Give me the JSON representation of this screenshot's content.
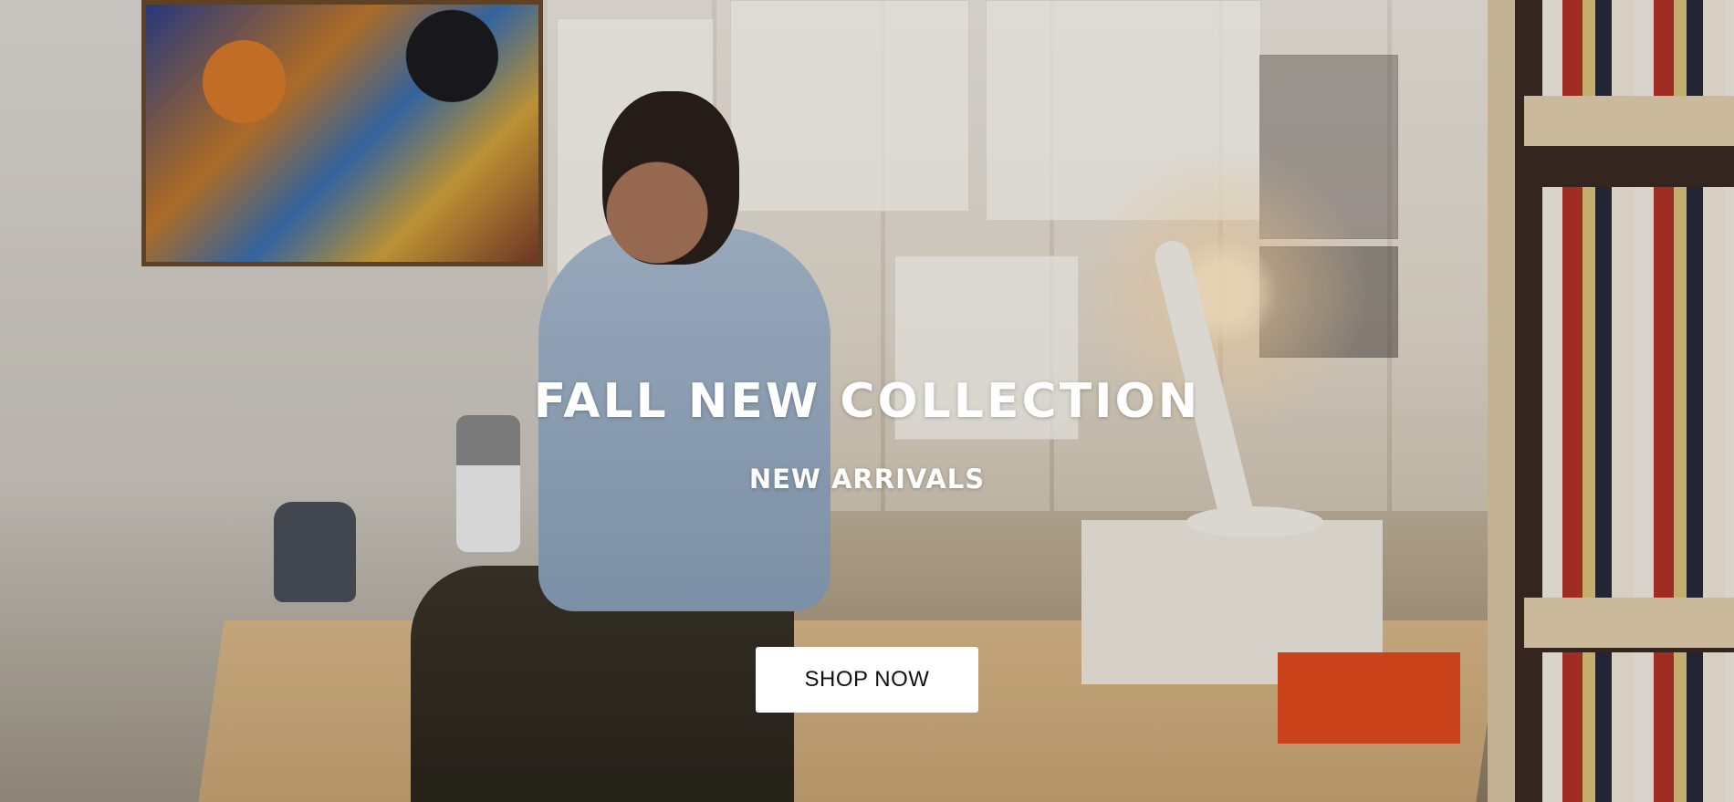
{
  "hero": {
    "title": "FALL NEW COLLECTION",
    "subtitle": "NEW ARRIVALS",
    "cta_label": "SHOP NOW"
  },
  "colors": {
    "text": "#ffffff",
    "button_bg": "#ffffff",
    "button_text": "#111111"
  }
}
